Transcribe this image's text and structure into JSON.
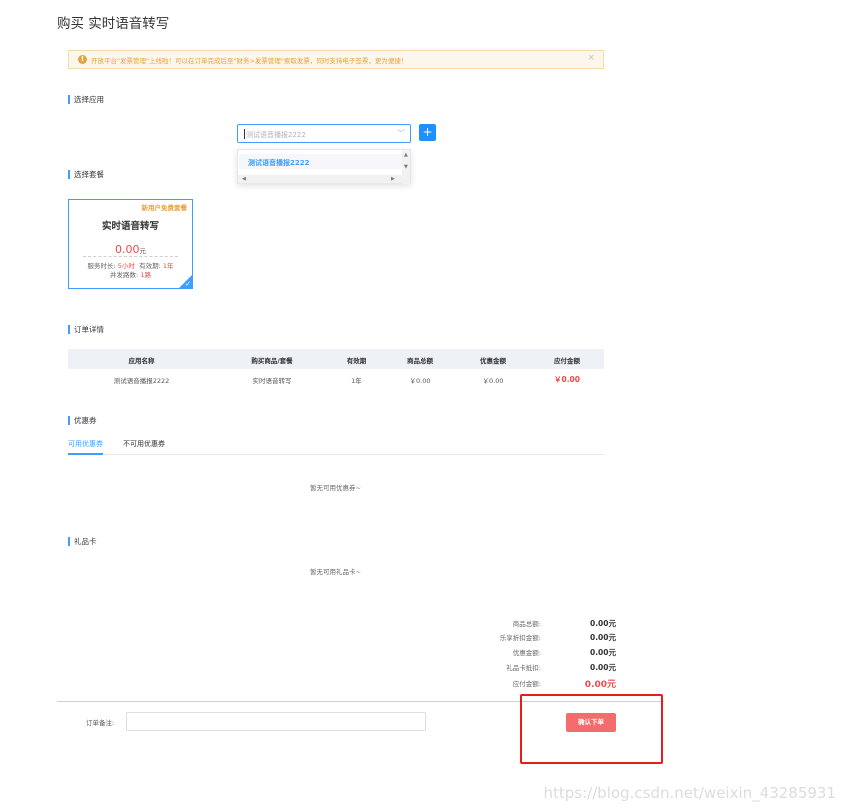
{
  "page": {
    "title": "购买 实时语音转写"
  },
  "notice": {
    "text": "开放平台\"发票管理\"上线啦！可以在订单完成后至\"财务>发票管理\"索取发票，同时支持电子签票，更为便捷！",
    "icon": "warning-icon",
    "close": "×"
  },
  "sections": {
    "app": "选择应用",
    "package": "选择套餐",
    "order": "订单详情",
    "coupon": "优惠券",
    "giftcard": "礼品卡"
  },
  "app_select": {
    "value": "测试语音播报2222",
    "arrow": "﹀",
    "add_label": "+",
    "dropdown": {
      "options": [
        "测试语音播报2222"
      ]
    }
  },
  "package_card": {
    "promo": "新用户免费套餐",
    "name": "实时语音转写",
    "price": "0.00",
    "price_unit": "元",
    "duration_label": "服务时长:",
    "duration_value": "5小时",
    "validity_label": "有效期:",
    "validity_value": "1年",
    "concurrency_label": "并发路数:",
    "concurrency_value": "1路",
    "check": "✓"
  },
  "order_table": {
    "headers": [
      "应用名称",
      "购买商品/套餐",
      "有效期",
      "商品总额",
      "优惠金额",
      "应付金额"
    ],
    "rows": [
      [
        "测试语音播报2222",
        "实时语音转写",
        "1年",
        "￥0.00",
        "￥0.00",
        "￥0.00"
      ]
    ]
  },
  "coupon_tabs": {
    "active": "可用优惠券",
    "inactive": "不可用优惠券"
  },
  "coupon_empty": "暂无可用优惠券~",
  "giftcard_empty": "暂无可用礼品卡~",
  "summary": [
    {
      "label": "商品总额:",
      "value": "0.00元"
    },
    {
      "label": "乐享折扣金额:",
      "value": "0.00元"
    },
    {
      "label": "优惠金额:",
      "value": "0.00元"
    },
    {
      "label": "礼品卡抵扣:",
      "value": "0.00元"
    },
    {
      "label": "应付金额:",
      "value": "0.00元"
    }
  ],
  "remark": {
    "label": "订单备注:",
    "value": ""
  },
  "confirm_button": "确认下单",
  "watermark": "https://blog.csdn.net/weixin_43285931",
  "colors": {
    "accent": "#409eff",
    "price": "#f04848",
    "confirm": "#f56c6c",
    "highlight_box": "#e0201c",
    "notice_bg": "#fdf6ec"
  }
}
